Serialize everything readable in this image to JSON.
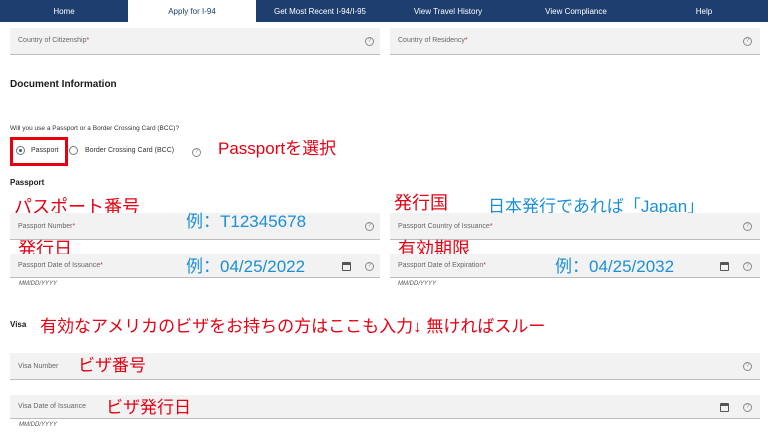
{
  "nav": {
    "items": [
      "Home",
      "Apply for I-94",
      "Get Most Recent I-94/I-95",
      "View Travel History",
      "View Compliance",
      "Help"
    ],
    "active": "Apply for I-94"
  },
  "fields": {
    "citizenship": {
      "label": "Country of Citizenship"
    },
    "residency": {
      "label": "Country of Residency"
    },
    "passport_number": {
      "label": "Passport Number"
    },
    "passport_country": {
      "label": "Passport Country of Issuance"
    },
    "passport_issue_date": {
      "label": "Passport Date of Issuance",
      "hint": "MM/DD/YYYY"
    },
    "passport_expiration": {
      "label": "Passport Date of Expiration",
      "hint": "MM/DD/YYYY"
    },
    "visa_number": {
      "label": "Visa Number"
    },
    "visa_issue_date": {
      "label": "Visa Date of Issuance",
      "hint": "MM/DD/YYYY"
    }
  },
  "required_mark": "*",
  "help_glyph": "?",
  "document": {
    "title": "Document Information",
    "question": "Will you use a Passport or a Border Crossing Card (BCC)?",
    "options": [
      "Passport",
      "Border Crossing Card (BCC)"
    ],
    "selected": "Passport"
  },
  "sections": {
    "passport": "Passport",
    "visa": "Visa"
  },
  "annotations": {
    "select_passport": "Passportを選択",
    "passport_number": "パスポート番号",
    "passport_number_example": "例：T12345678",
    "issuing_country": "発行国",
    "issuing_country_example": "日本発行であれば「Japan」",
    "issue_date": "発行日",
    "issue_date_example": "例：04/25/2022",
    "validity": "有効期限",
    "validity_example": "例：04/25/2032",
    "visa_note": "有効なアメリカのビザをお持ちの方はここも入力↓ 無ければスルー",
    "visa_number": "ビザ番号",
    "visa_issue_date": "ビザ発行日"
  },
  "colors": {
    "nav_bg": "#1d3e6e",
    "annotation_red": "#e60012",
    "annotation_blue": "#1a8fd8",
    "required": "#d62b2b"
  }
}
